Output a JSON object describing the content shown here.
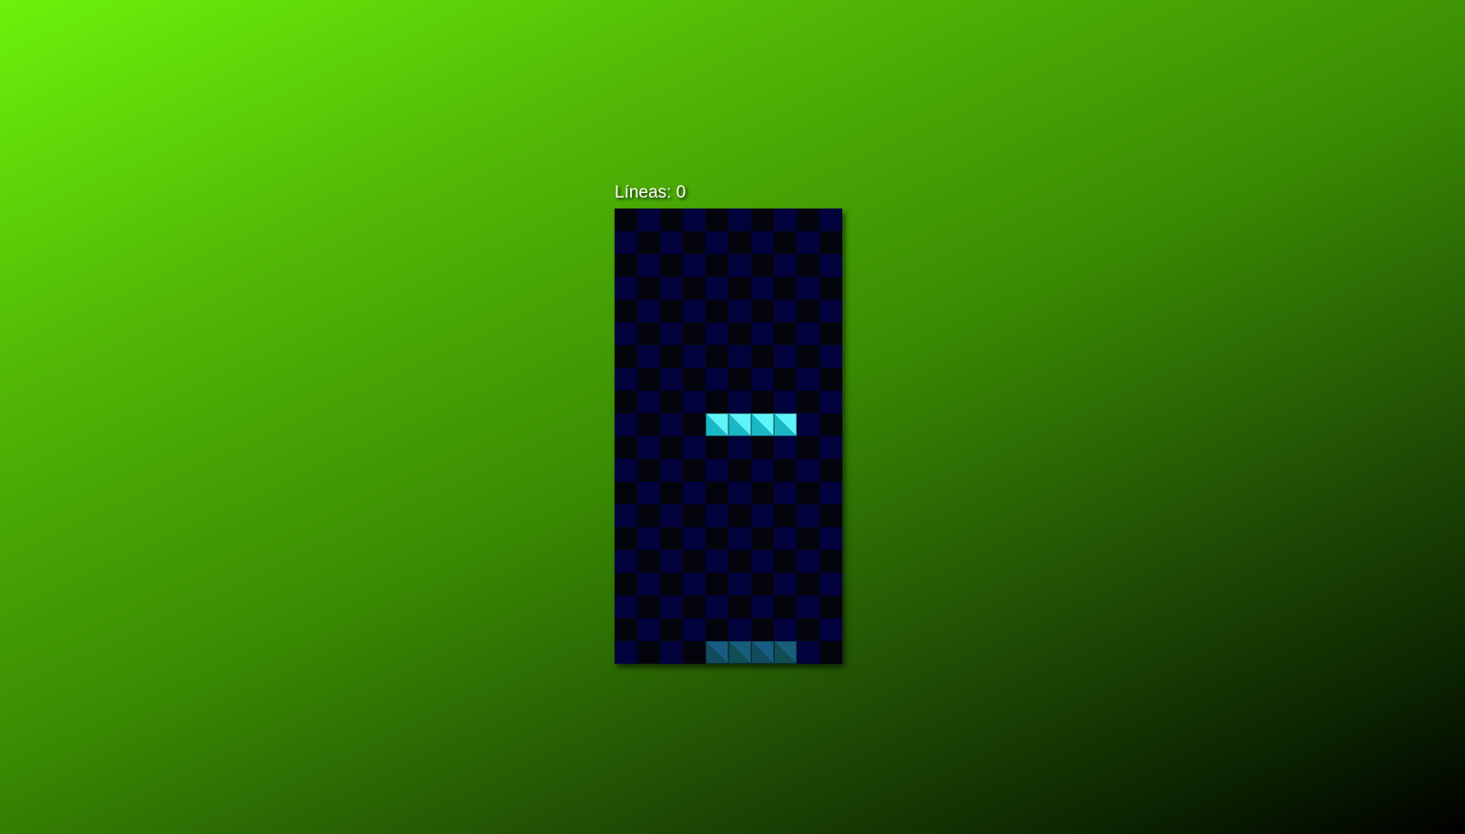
{
  "hud": {
    "lines_label": "Líneas: 0"
  },
  "board": {
    "columns": 10,
    "rows": 20,
    "checker_colors": [
      "#04040d",
      "#02023d"
    ],
    "active_piece": {
      "name": "I",
      "color_light": "#5ff5f8",
      "color_dark": "#1ab8c6",
      "cells": [
        [
          4,
          9
        ],
        [
          5,
          9
        ],
        [
          6,
          9
        ],
        [
          7,
          9
        ]
      ]
    },
    "ghost_piece": {
      "color_light": "#1b6e8e",
      "color_dark": "#155a62",
      "cells": [
        [
          4,
          19
        ],
        [
          5,
          19
        ],
        [
          6,
          19
        ],
        [
          7,
          19
        ]
      ]
    }
  }
}
